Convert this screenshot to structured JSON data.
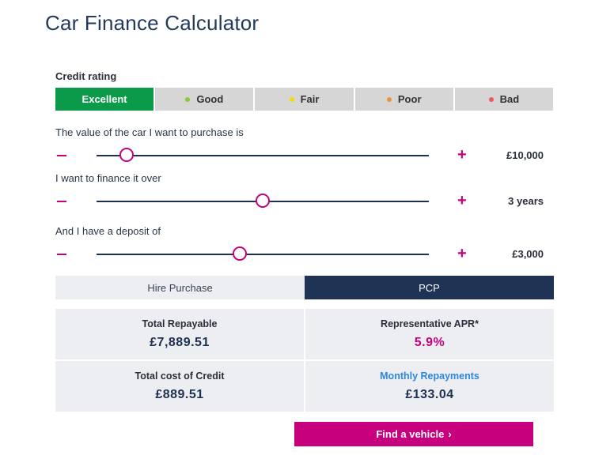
{
  "title": "Car Finance Calculator",
  "credit_rating": {
    "label": "Credit rating",
    "options": [
      {
        "label": "Excellent",
        "dot_color": null,
        "selected": true
      },
      {
        "label": "Good",
        "dot_color": "#8dc63f",
        "selected": false
      },
      {
        "label": "Fair",
        "dot_color": "#f5d90a",
        "selected": false
      },
      {
        "label": "Poor",
        "dot_color": "#f0923a",
        "selected": false
      },
      {
        "label": "Bad",
        "dot_color": "#ee5a5a",
        "selected": false
      }
    ]
  },
  "sliders": [
    {
      "label": "The value of the car I want to purchase is",
      "value": "£10,000",
      "position_fraction": 0.09
    },
    {
      "label": "I want to finance it over",
      "value": "3 years",
      "position_fraction": 0.5
    },
    {
      "label": "And I have a deposit of",
      "value": "£3,000",
      "position_fraction": 0.43
    }
  ],
  "controls": {
    "minus": "−",
    "plus": "+"
  },
  "finance_tabs": [
    {
      "label": "Hire Purchase",
      "active": false
    },
    {
      "label": "PCP",
      "active": true
    }
  ],
  "results": {
    "total_repayable": {
      "label": "Total Repayable",
      "value": "£7,889.51"
    },
    "apr": {
      "label": "Representative APR*",
      "value": "5.9%"
    },
    "total_cost_credit": {
      "label": "Total cost of Credit",
      "value": "£889.51"
    },
    "monthly": {
      "label": "Monthly Repayments",
      "value": "£133.04"
    }
  },
  "cta": {
    "label": "Find a vehicle",
    "icon": "›"
  },
  "colors": {
    "accent": "#c7007d",
    "primary": "#1f3455",
    "selected_green": "#0a9a4a",
    "link_blue": "#2e86de"
  }
}
